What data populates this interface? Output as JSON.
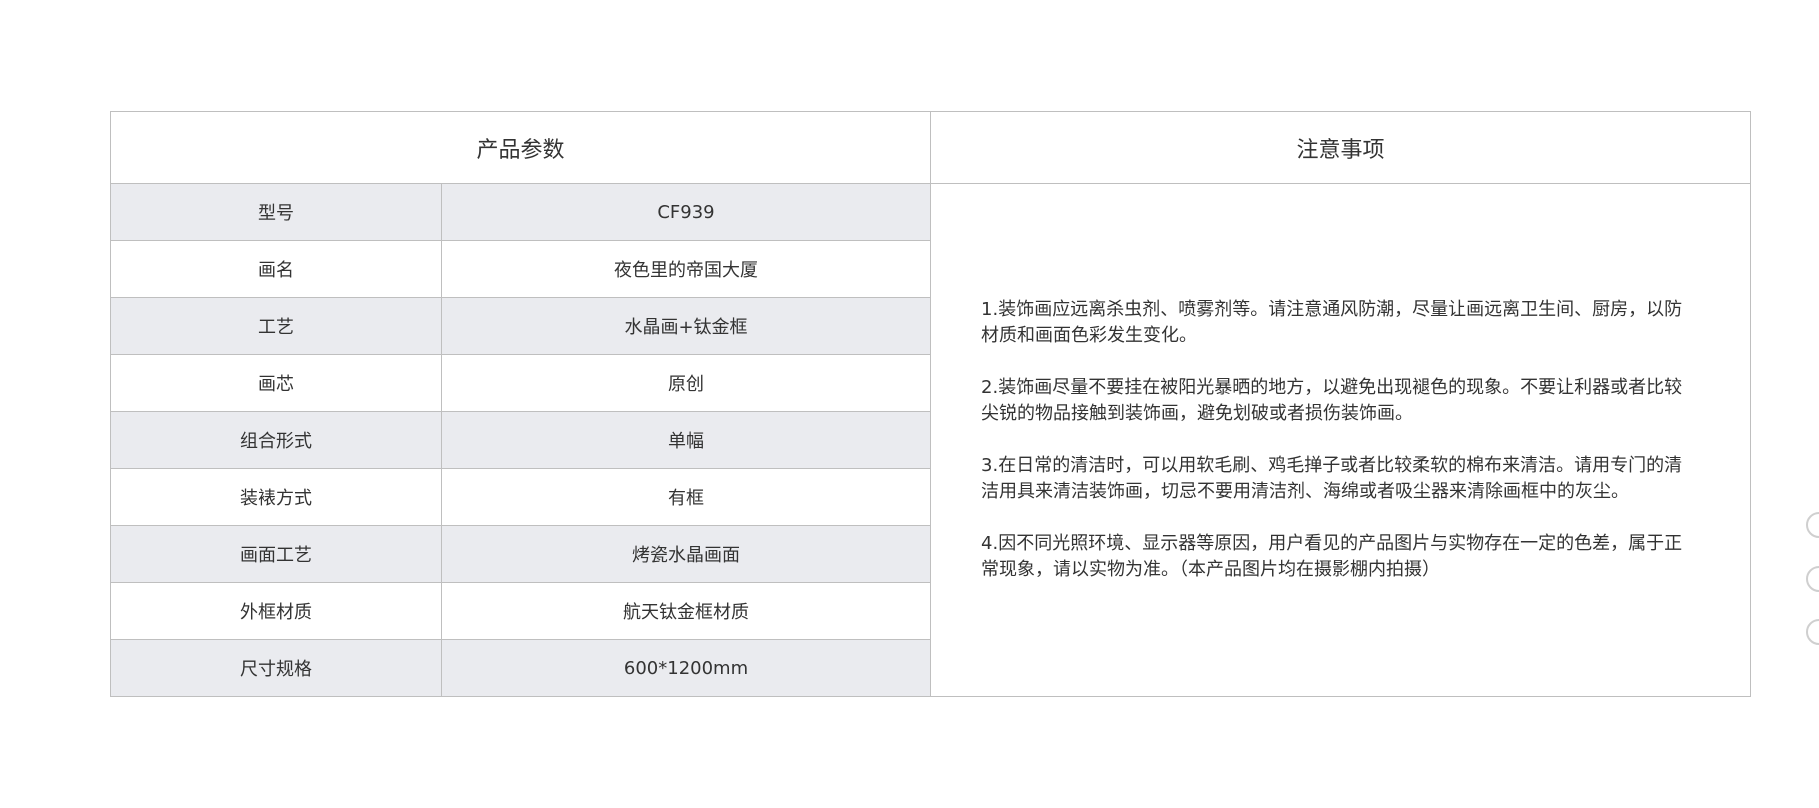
{
  "table": {
    "params_header": "产品参数",
    "notes_header": "注意事项",
    "rows": [
      {
        "label": "型号",
        "value": "CF939"
      },
      {
        "label": "画名",
        "value": "夜色里的帝国大厦"
      },
      {
        "label": "工艺",
        "value": "水晶画+钛金框"
      },
      {
        "label": "画芯",
        "value": "原创"
      },
      {
        "label": "组合形式",
        "value": "单幅"
      },
      {
        "label": "装裱方式",
        "value": "有框"
      },
      {
        "label": "画面工艺",
        "value": "烤瓷水晶画面"
      },
      {
        "label": "外框材质",
        "value": "航天钛金框材质"
      },
      {
        "label": "尺寸规格",
        "value": "600*1200mm"
      }
    ],
    "notes": [
      "1.装饰画应远离杀虫剂、喷雾剂等。请注意通风防潮，尽量让画远离卫生间、厨房，以防材质和画面色彩发生变化。",
      "2.装饰画尽量不要挂在被阳光暴晒的地方，以避免出现褪色的现象。不要让利器或者比较尖锐的物品接触到装饰画，避免划破或者损伤装饰画。",
      "3.在日常的清洁时，可以用软毛刷、鸡毛掸子或者比较柔软的棉布来清洁。请用专门的清洁用具来清洁装饰画，切忌不要用清洁剂、海绵或者吸尘器来清除画框中的灰尘。",
      "4.因不同光照环境、显示器等原因，用户看见的产品图片与实物存在一定的色差，属于正常现象，请以实物为准。（本产品图片均在摄影棚内拍摄）"
    ]
  },
  "colors": {
    "shaded_row": "#eaebef",
    "border": "#bfbfbf",
    "text": "#333333"
  }
}
